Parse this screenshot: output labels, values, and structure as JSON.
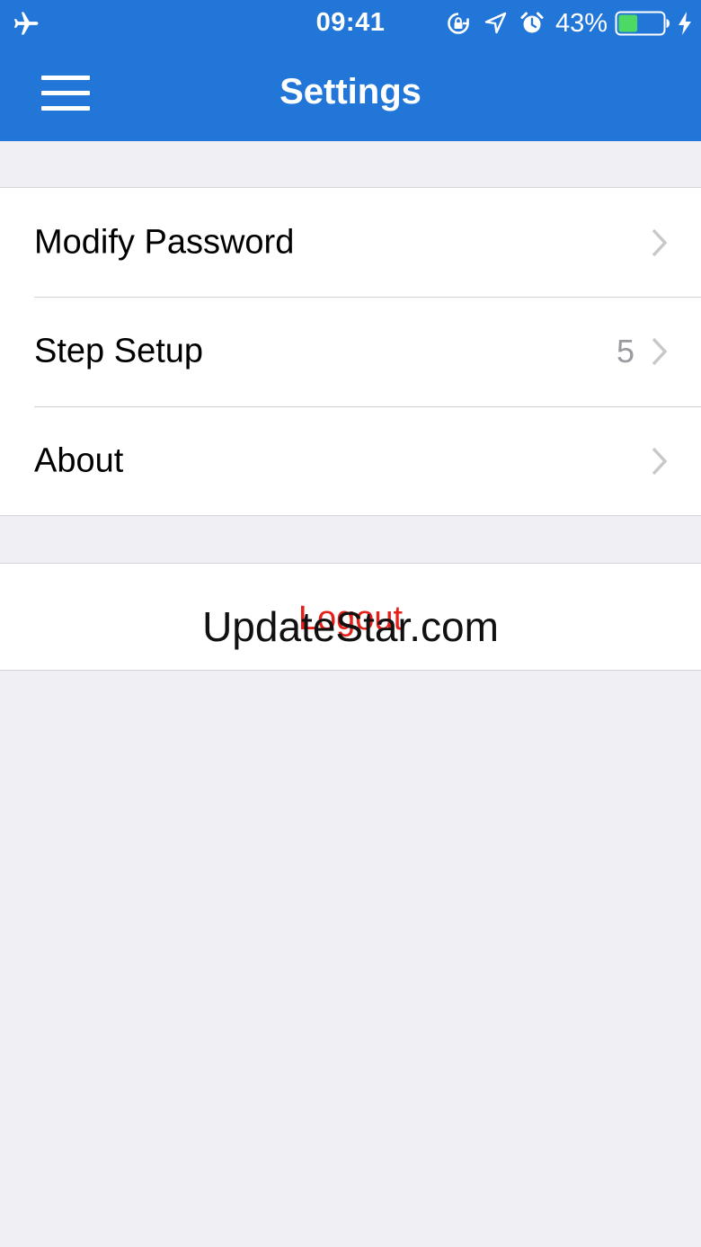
{
  "status_bar": {
    "time": "09:41",
    "battery_percent": "43%",
    "icons": [
      "airplane-icon",
      "rotation-lock-icon",
      "location-arrow-icon",
      "alarm-icon",
      "battery-icon",
      "charging-bolt-icon"
    ]
  },
  "nav": {
    "title": "Settings",
    "menu_icon": "hamburger-menu-icon"
  },
  "settings": {
    "items": [
      {
        "label": "Modify Password",
        "detail": ""
      },
      {
        "label": "Step Setup",
        "detail": "5"
      },
      {
        "label": "About",
        "detail": ""
      }
    ],
    "logout_label": "Logout"
  },
  "watermark": "UpdateStar.com",
  "colors": {
    "accent": "#2176d8",
    "background": "#efeff4",
    "destructive": "#e5201b",
    "battery_fill": "#4cd964"
  }
}
